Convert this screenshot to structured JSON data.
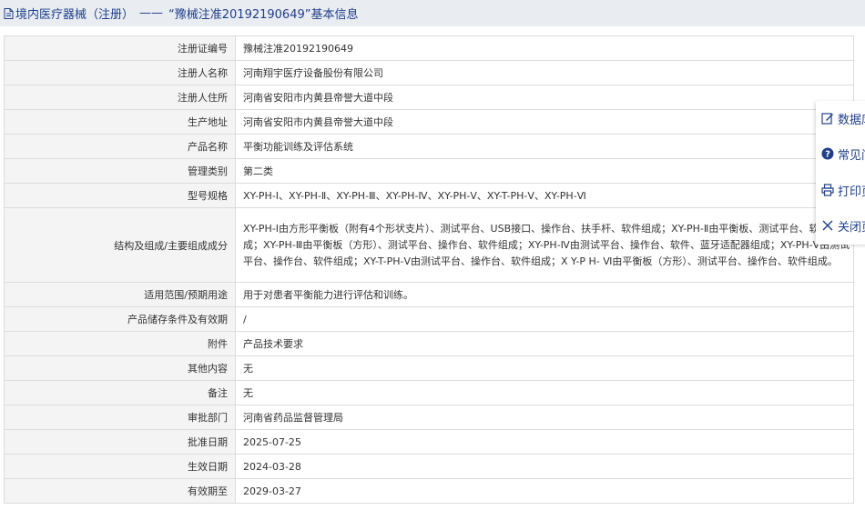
{
  "breadcrumb": {
    "category": "境内医疗器械（注册）",
    "separator": "——",
    "title": "“豫械注准20192190649”基本信息"
  },
  "fields": [
    {
      "label": "注册证编号",
      "value": "豫械注准20192190649"
    },
    {
      "label": "注册人名称",
      "value": "河南翔宇医疗设备股份有限公司"
    },
    {
      "label": "注册人住所",
      "value": "河南省安阳市内黄县帝誉大道中段"
    },
    {
      "label": "生产地址",
      "value": "河南省安阳市内黄县帝誉大道中段"
    },
    {
      "label": "产品名称",
      "value": "平衡功能训练及评估系统"
    },
    {
      "label": "管理类别",
      "value": "第二类"
    },
    {
      "label": "型号规格",
      "value": "XY-PH-Ⅰ、XY-PH-Ⅱ、XY-PH-Ⅲ、XY-PH-Ⅳ、XY-PH-Ⅴ、XY-T-PH-Ⅴ、XY-PH-Ⅵ"
    },
    {
      "label": "结构及组成/主要组成成分",
      "value": "XY-PH-Ⅰ由方形平衡板（附有4个形状支片）、测试平台、USB接口、操作台、扶手杆、软件组成；XY-PH-Ⅱ由平衡板、测试平台、软件组成；XY-PH-Ⅲ由平衡板（方形）、测试平台、操作台、软件组成；XY-PH-Ⅳ由测试平台、操作台、软件、蓝牙适配器组成；XY-PH-Ⅴ由测试平台、操作台、软件组成；XY-T-PH-Ⅴ由测试平台、操作台、软件组成；X Y-P H- Ⅵ由平衡板（方形）、测试平台、操作台、软件组成。"
    },
    {
      "label": "适用范围/预期用途",
      "value": "用于对患者平衡能力进行评估和训练。"
    },
    {
      "label": "产品储存条件及有效期",
      "value": "/"
    },
    {
      "label": "附件",
      "value": "产品技术要求"
    },
    {
      "label": "其他内容",
      "value": "无"
    },
    {
      "label": "备注",
      "value": "无"
    },
    {
      "label": "审批部门",
      "value": "河南省药品监督管理局"
    },
    {
      "label": "批准日期",
      "value": "2025-07-25"
    },
    {
      "label": "生效日期",
      "value": "2024-03-28"
    },
    {
      "label": "有效期至",
      "value": "2029-03-27"
    }
  ],
  "side_panel": {
    "items": [
      {
        "label": "数据库",
        "icon": "edit-icon"
      },
      {
        "label": "常见问题",
        "icon": "question-icon"
      },
      {
        "label": "打印页面",
        "icon": "print-icon"
      },
      {
        "label": "关闭页面",
        "icon": "close-icon"
      }
    ]
  },
  "colors": {
    "link": "#1f3f8a",
    "header_bg": "#e9ecf1",
    "label_bg": "#f4f4f4",
    "border": "#dcdcdc"
  }
}
